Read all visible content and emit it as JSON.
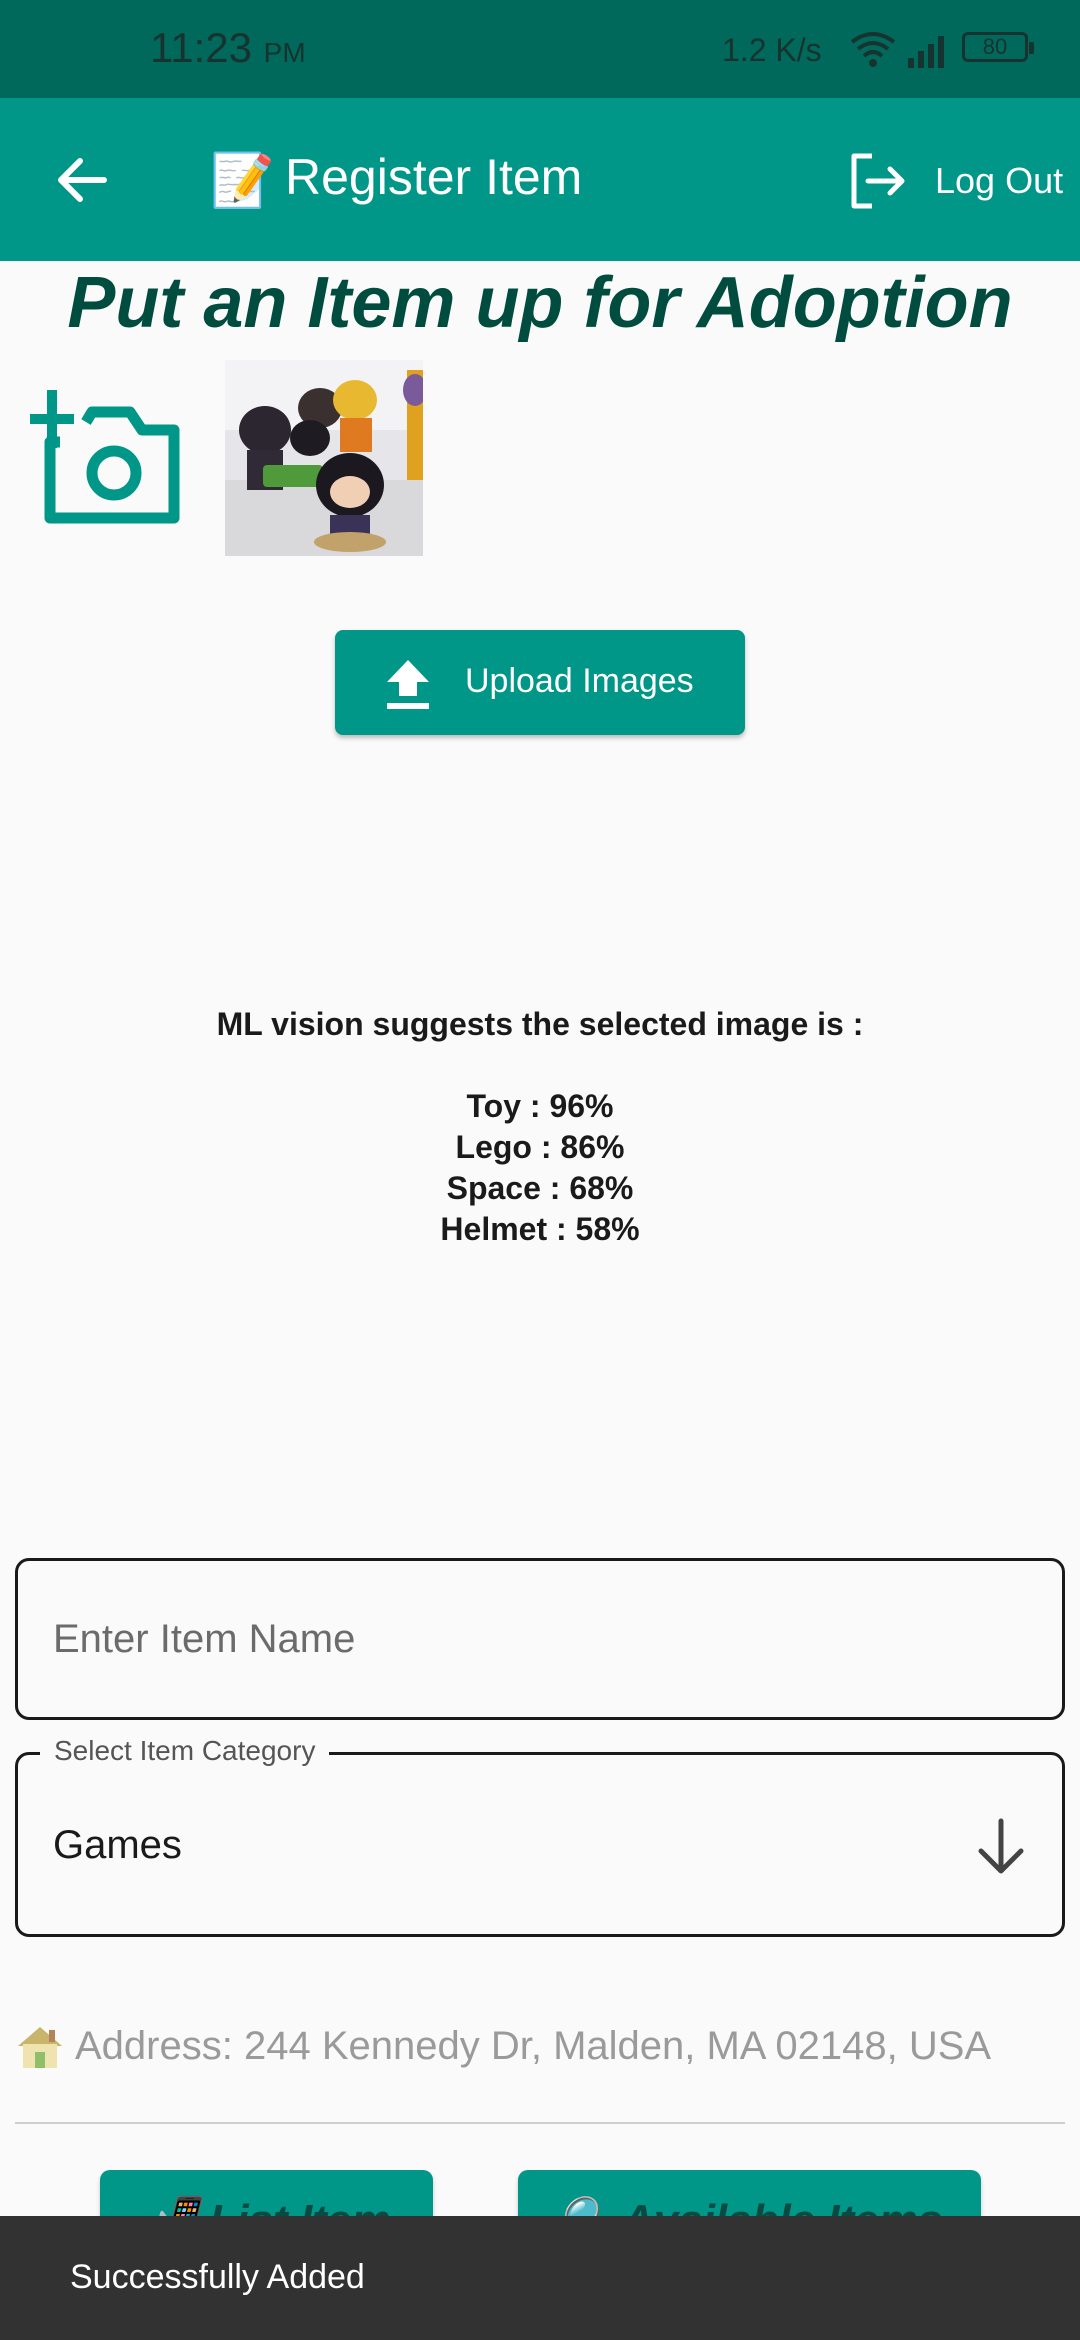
{
  "status_bar": {
    "time": "11:23",
    "ampm": "PM",
    "net_speed": "1.2 K/s",
    "battery": "80",
    "icons": [
      "wifi-icon",
      "signal-icon",
      "battery-icon"
    ]
  },
  "app_bar": {
    "title_emoji": "📝",
    "title": "Register Item",
    "logout_label": "Log Out",
    "icons": [
      "back-arrow-icon",
      "logout-icon"
    ]
  },
  "heading": "Put an Item up for Adoption",
  "camera_icon": "add-a-photo-icon",
  "upload_button": {
    "label": "Upload Images",
    "icon": "upload-icon"
  },
  "ml_vision": {
    "title": "ML vision suggests the selected image is :",
    "labels": [
      "Toy : 96%",
      "Lego : 86%",
      "Space : 68%",
      "Helmet : 58%"
    ]
  },
  "item_name_field": {
    "placeholder": "Enter Item Name",
    "value": ""
  },
  "category_field": {
    "label": "Select Item Category",
    "value": "Games",
    "icon": "arrow-down-icon"
  },
  "address": {
    "icon": "house-icon",
    "text": "Address: 244 Kennedy Dr, Malden, MA 02148, USA"
  },
  "bottom_buttons": {
    "list_item": "📲 List Item",
    "available_items": "🔍 Available Items"
  },
  "snackbar": {
    "message": "Successfully Added"
  },
  "colors": {
    "status_bar": "#00695c",
    "app_bar": "#009688",
    "heading": "#004d40",
    "snackbar": "#323232"
  }
}
